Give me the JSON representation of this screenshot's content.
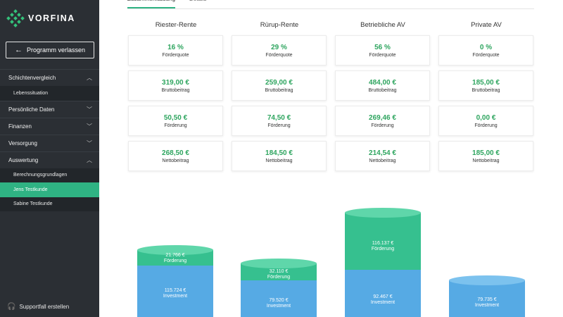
{
  "app": {
    "logo_text": "VORFINA",
    "brand_color": "#34c27a",
    "accent_color": "#2fb383"
  },
  "sidebar": {
    "exit_label": "Programm verlassen",
    "items": [
      {
        "label": "Schichtenvergleich",
        "expanded": true
      },
      {
        "label": "Lebenssituation",
        "sub": true
      },
      {
        "label": "Persönliche Daten",
        "expanded": false
      },
      {
        "label": "Finanzen",
        "expanded": false
      },
      {
        "label": "Versorgung",
        "expanded": false
      },
      {
        "label": "Auswertung",
        "expanded": true
      },
      {
        "label": "Berechnungsgrundlagen",
        "sub": true
      },
      {
        "label": "Jens Testkunde",
        "sub": true,
        "active": true
      },
      {
        "label": "Sabine Testkunde",
        "sub": true
      }
    ],
    "support_label": "Supportfall erstellen"
  },
  "tabs": [
    {
      "label": "Zusammenfassung",
      "active": true
    },
    {
      "label": "Details",
      "active": false
    }
  ],
  "columns": [
    {
      "title": "Riester-Rente",
      "cards": [
        {
          "value": "16 %",
          "label": "Förderquote"
        },
        {
          "value": "319,00 €",
          "label": "Bruttobeitrag"
        },
        {
          "value": "50,50 €",
          "label": "Förderung"
        },
        {
          "value": "268,50 €",
          "label": "Nettobeitrag"
        }
      ]
    },
    {
      "title": "Rürup-Rente",
      "cards": [
        {
          "value": "29 %",
          "label": "Förderquote"
        },
        {
          "value": "259,00 €",
          "label": "Bruttobeitrag"
        },
        {
          "value": "74,50 €",
          "label": "Förderung"
        },
        {
          "value": "184,50 €",
          "label": "Nettobeitrag"
        }
      ]
    },
    {
      "title": "Betriebliche AV",
      "cards": [
        {
          "value": "56 %",
          "label": "Förderquote"
        },
        {
          "value": "484,00 €",
          "label": "Bruttobeitrag"
        },
        {
          "value": "269,46 €",
          "label": "Förderung"
        },
        {
          "value": "214,54 €",
          "label": "Nettobeitrag"
        }
      ]
    },
    {
      "title": "Private AV",
      "cards": [
        {
          "value": "0 %",
          "label": "Förderquote"
        },
        {
          "value": "185,00 €",
          "label": "Bruttobeitrag"
        },
        {
          "value": "0,00 €",
          "label": "Förderung"
        },
        {
          "value": "185,00 €",
          "label": "Nettobeitrag"
        }
      ]
    }
  ],
  "chart": {
    "colors": {
      "foerderung": "#36c08f",
      "investment": "#4aa3e3"
    },
    "bars": [
      {
        "foerderung_value": "21.766 €",
        "foerderung_label": "Förderung",
        "investment_value": "115.724 €",
        "investment_label": "Investment"
      },
      {
        "foerderung_value": "32.110 €",
        "foerderung_label": "Förderung",
        "investment_value": "79.520 €",
        "investment_label": "Investment"
      },
      {
        "foerderung_value": "116.137 €",
        "foerderung_label": "Förderung",
        "investment_value": "92.467 €",
        "investment_label": "Investment"
      },
      {
        "foerderung_value": "",
        "foerderung_label": "",
        "investment_value": "79.735 €",
        "investment_label": "Investment"
      }
    ]
  },
  "chart_data": {
    "type": "bar",
    "categories": [
      "Riester-Rente",
      "Rürup-Rente",
      "Betriebliche AV",
      "Private AV"
    ],
    "series": [
      {
        "name": "Förderung",
        "values": [
          21766,
          32110,
          116137,
          0
        ]
      },
      {
        "name": "Investment",
        "values": [
          115724,
          79520,
          92467,
          79735
        ]
      }
    ],
    "stacked": true
  }
}
